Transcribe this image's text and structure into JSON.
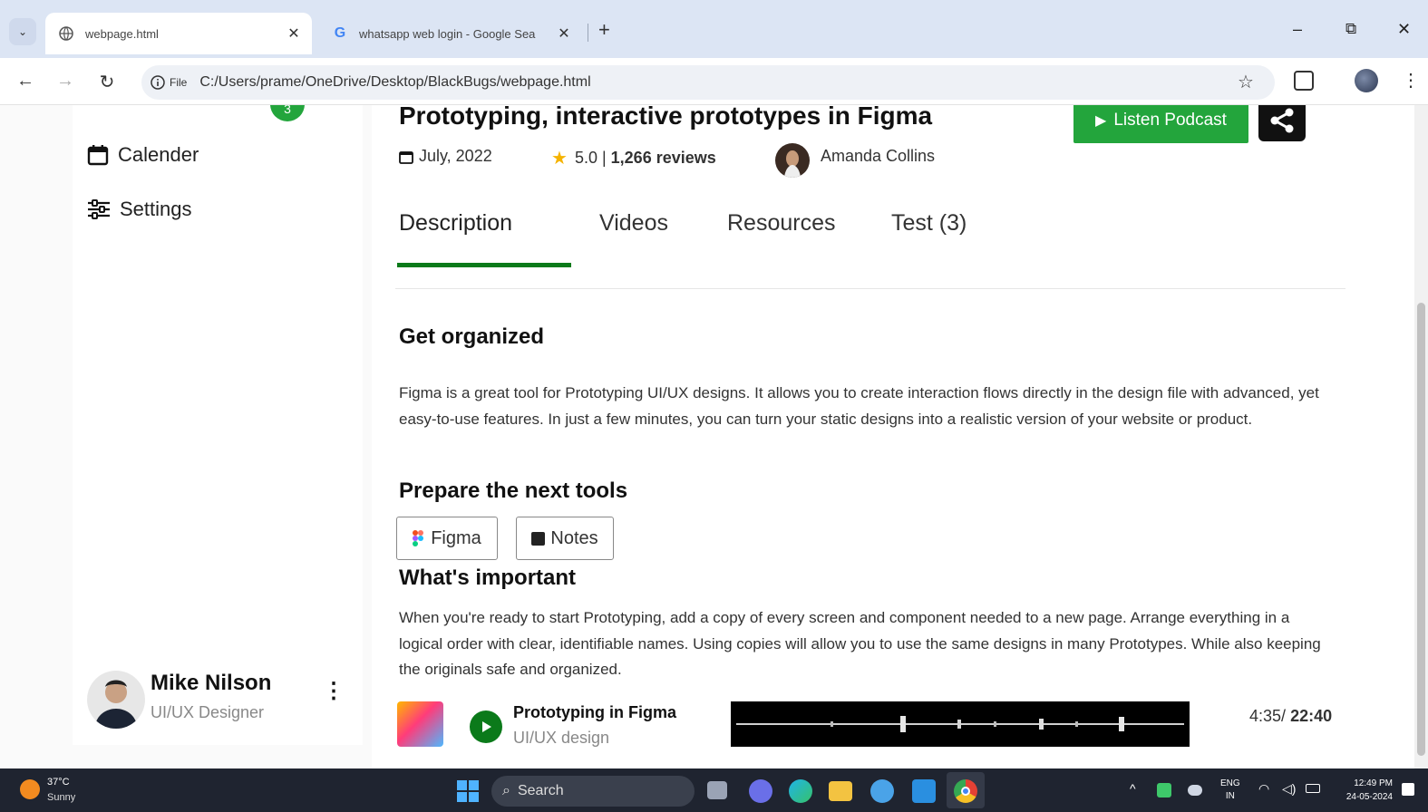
{
  "browser": {
    "tabs": [
      {
        "title": "webpage.html",
        "active": true
      },
      {
        "title": "whatsapp web login - Google Sea",
        "active": false
      }
    ],
    "new_tab": "+",
    "window_controls": {
      "minimize": "–",
      "restore": "⧉",
      "close": "✕"
    },
    "address": {
      "chip": "File",
      "url": "C:/Users/prame/OneDrive/Desktop/BlackBugs/webpage.html"
    }
  },
  "sidebar": {
    "items": [
      {
        "label": "Calender",
        "icon": "calendar-icon"
      },
      {
        "label": "Settings",
        "icon": "settings-sliders-icon"
      }
    ],
    "messages_badge": "3",
    "user": {
      "name": "Mike Nilson",
      "role": "UI/UX Designer"
    }
  },
  "course": {
    "title": "Prototyping, interactive prototypes in Figma",
    "date": "July, 2022",
    "rating": "5.0",
    "reviews": "1,266 reviews",
    "author": "Amanda Collins",
    "podcast_label": "Listen Podcast"
  },
  "tabs": [
    {
      "label": "Description",
      "active": true
    },
    {
      "label": "Videos"
    },
    {
      "label": "Resources"
    },
    {
      "label": "Test (3)"
    }
  ],
  "content": {
    "get_organized": {
      "heading": "Get organized",
      "text": "Figma is a great tool for Prototyping UI/UX designs. It allows you to create interaction flows directly in the design file with advanced, yet easy-to-use features. In just a few minutes, you can turn your static designs into a realistic version of your website or product."
    },
    "tools": {
      "heading": "Prepare the next tools",
      "items": [
        "Figma",
        "Notes"
      ]
    },
    "important": {
      "heading": "What's important",
      "text": "When you're ready to start Prototyping, add a copy of every screen and component needed to a new page. Arrange everything in a logical order with clear, identifiable names. Using copies will allow you to use the same designs in many Prototypes. While also keeping the originals safe and organized."
    }
  },
  "player": {
    "title": "Prototyping in Figma",
    "subtitle": "UI/UX design",
    "current": "4:35/",
    "total": "22:40"
  },
  "taskbar": {
    "weather_temp": "37°C",
    "weather_desc": "Sunny",
    "search": "Search",
    "lang": "ENG",
    "region": "IN",
    "time": "12:49 PM",
    "date": "24-05-2024"
  },
  "colors": {
    "accent_green": "#23a53c",
    "dark_green": "#0b7a1a",
    "star": "#f5b301"
  }
}
